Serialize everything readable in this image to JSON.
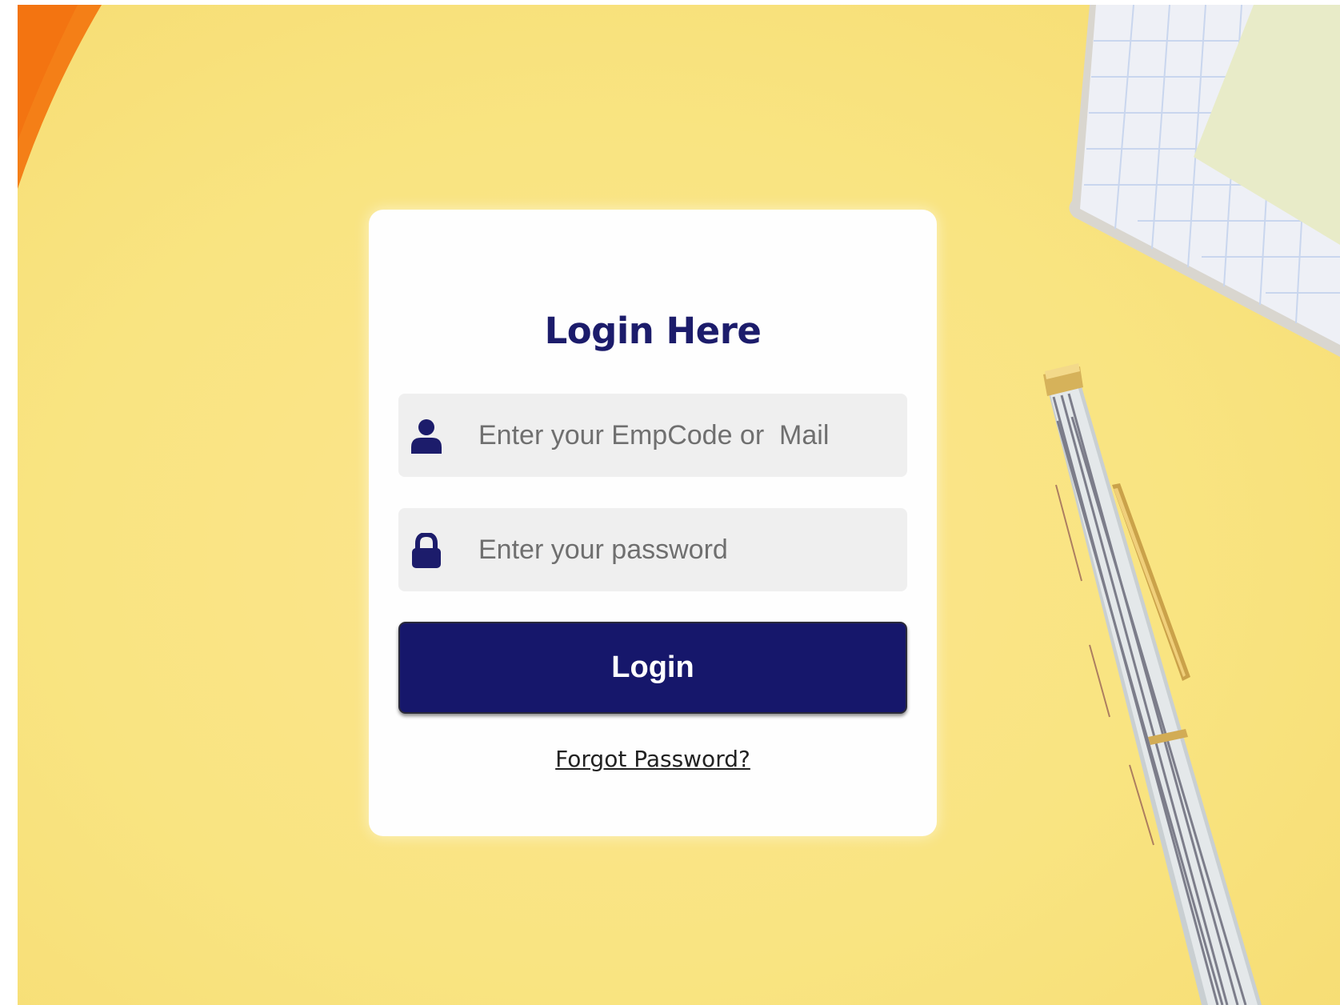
{
  "login_form": {
    "title": "Login Here",
    "username_placeholder": "Enter your EmpCode or  Mail",
    "username_value": "",
    "password_placeholder": "Enter your password",
    "password_value": "",
    "login_button_label": "Login",
    "forgot_password_label": "Forgot Password?"
  },
  "icons": {
    "username": "user-icon",
    "password": "lock-icon"
  },
  "colors": {
    "brand_navy": "#1c1c6b",
    "button_bg": "#16176b",
    "page_background": "#f9e481",
    "field_bg": "#efefef",
    "card_bg": "#fefefe"
  }
}
